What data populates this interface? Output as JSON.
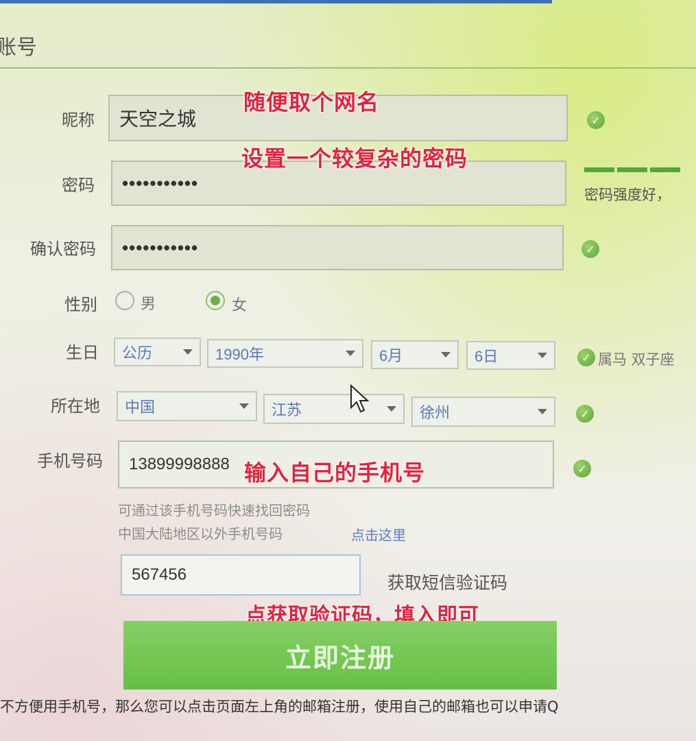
{
  "page": {
    "title": "账号"
  },
  "form": {
    "nickname": {
      "label": "昵称",
      "value": "天空之城"
    },
    "password": {
      "label": "密码",
      "value": "•••••••••••",
      "strength_text": "密码强度好，"
    },
    "confirm_password": {
      "label": "确认密码",
      "value": "•••••••••••"
    },
    "gender": {
      "label": "性别",
      "options": [
        "男",
        "女"
      ],
      "selected": "女"
    },
    "birthday": {
      "label": "生日",
      "calendar": "公历",
      "year": "1990年",
      "month": "6月",
      "day": "6日",
      "zodiac": "属马 双子座"
    },
    "location": {
      "label": "所在地",
      "country": "中国",
      "province": "江苏",
      "city": "徐州"
    },
    "phone": {
      "label": "手机号码",
      "value": "13899998888",
      "hint1": "可通过该手机号码快速找回密码",
      "hint2": "中国大陆地区以外手机号码",
      "hint_link": "点击这里"
    },
    "sms": {
      "value": "567456",
      "get_code_label": "获取短信验证码"
    },
    "submit_label": "立即注册"
  },
  "annotations": {
    "nickname": "随便取个网名",
    "password": "设置一个较复杂的密码",
    "phone": "输入自己的手机号",
    "sms": "点获取验证码，填入即可"
  },
  "footer": {
    "text": "不方便用手机号，那么您可以点击页面左上角的邮箱注册，使用自己的邮箱也可以申请Q"
  },
  "colors": {
    "annotation": "#e8203a",
    "accent_green": "#66bf44",
    "link_blue": "#5a80c8"
  }
}
